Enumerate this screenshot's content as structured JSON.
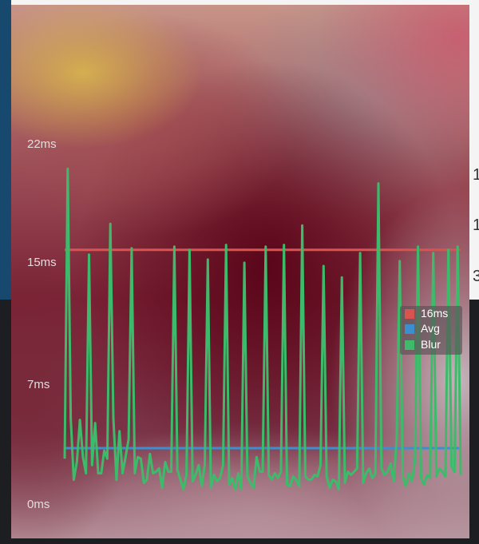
{
  "background_app": {
    "side_digits": [
      "1",
      "1",
      "3"
    ]
  },
  "chart_data": {
    "type": "line",
    "yunit": "ms",
    "ylim": [
      0,
      22
    ],
    "yticks": [
      "22ms",
      "15ms",
      "7ms",
      "0ms"
    ],
    "grid": false,
    "legend_position": "right",
    "series": [
      {
        "name": "16ms",
        "color": "#d9534f",
        "values": [
          15.7
        ]
      },
      {
        "name": "Avg",
        "color": "#3b8fd1",
        "values": [
          3.45
        ]
      },
      {
        "name": "Blur",
        "color": "#3dbb6b",
        "values": [
          2.8,
          20.7,
          5.3,
          1.5,
          2.6,
          5.2,
          2.9,
          1.9,
          15.4,
          2.4,
          5.0,
          1.9,
          1.9,
          3.3,
          2.8,
          17.3,
          5.3,
          1.5,
          4.5,
          1.9,
          2.9,
          4.0,
          15.8,
          1.9,
          2.9,
          2.8,
          1.3,
          1.5,
          3.1,
          1.9,
          2.0,
          2.2,
          1.0,
          2.6,
          2.0,
          2.0,
          15.9,
          2.1,
          1.5,
          0.9,
          1.8,
          15.7,
          1.4,
          1.8,
          2.4,
          1.1,
          2.4,
          15.1,
          1.0,
          1.8,
          1.4,
          1.6,
          2.4,
          16.0,
          1.2,
          1.6,
          0.9,
          1.9,
          0.9,
          14.9,
          1.7,
          1.3,
          1.0,
          2.9,
          2.0,
          2.0,
          15.9,
          1.8,
          1.5,
          1.9,
          1.6,
          2.0,
          16.0,
          1.2,
          1.1,
          1.7,
          1.5,
          1.1,
          17.2,
          1.7,
          1.5,
          1.5,
          1.8,
          1.7,
          2.4,
          14.7,
          1.7,
          1.0,
          1.5,
          1.4,
          0.9,
          14.0,
          1.3,
          2.0,
          1.8,
          2.0,
          2.2,
          15.5,
          1.3,
          1.9,
          2.2,
          1.6,
          1.9,
          19.8,
          2.2,
          1.8,
          2.0,
          2.5,
          1.4,
          4.0,
          15.0,
          1.7,
          1.1,
          1.9,
          1.4,
          2.7,
          15.9,
          1.6,
          1.2,
          1.8,
          1.6,
          15.5,
          1.7,
          2.2,
          2.0,
          1.7,
          15.7,
          2.3,
          2.0,
          15.9,
          1.8
        ]
      }
    ]
  }
}
